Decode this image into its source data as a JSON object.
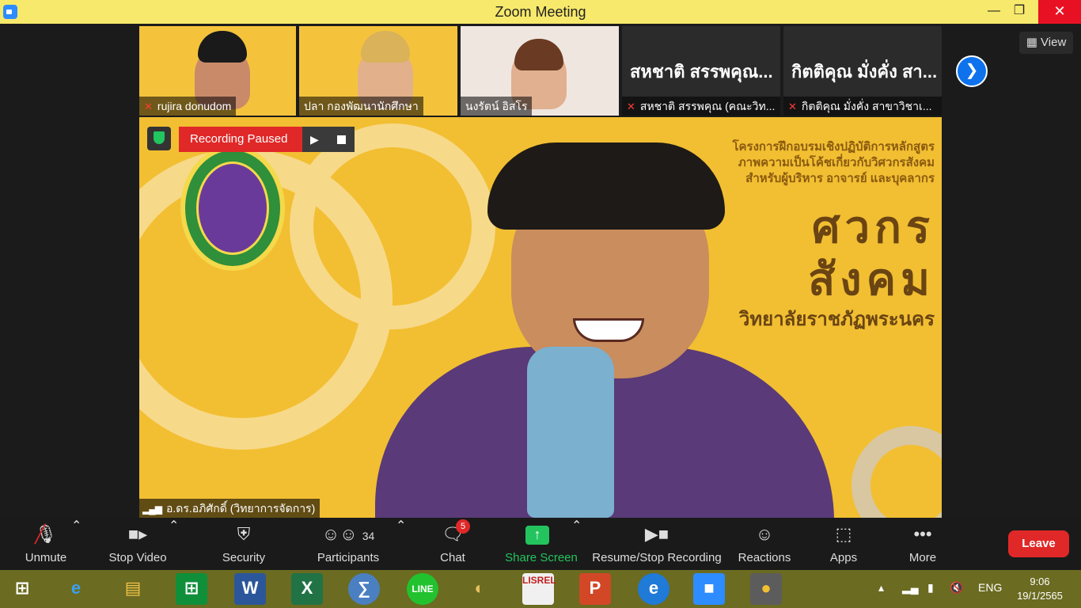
{
  "titlebar": {
    "title": "Zoom Meeting"
  },
  "thumbnails": [
    {
      "name": "rujira donudom",
      "muted": true
    },
    {
      "name": "ปลา กองพัฒนานักศึกษา",
      "muted": false
    },
    {
      "name": "นงรัตน์ อิสโร",
      "muted": false
    },
    {
      "display_name": "สหชาติ สรรพคุณ...",
      "name": "สหชาติ สรรพคุณ (คณะวิท...",
      "muted": true
    },
    {
      "display_name": "กิตติคุณ  มั่งคั่ง สา...",
      "name": "กิตติคุณ  มั่งคั่ง สาขาวิชาเ...",
      "muted": true
    }
  ],
  "view_button": {
    "label": "View"
  },
  "speaker": {
    "name": "อ.ดร.อภิศักดิ์ (วิทยาการจัดการ)",
    "recording_status": "Recording Paused",
    "banner_line1": "โครงการฝึกอบรมเชิงปฏิบัติการหลักสูตร",
    "banner_line2": "ภาพความเป็นโค้ชเกี่ยวกับวิศวกรสังคม",
    "banner_line3": "สำหรับผู้บริหาร อาจารย์ และบุคลากร",
    "banner_big1": "ศวกร",
    "banner_big2": "สังคม",
    "banner_sub": "วิทยาลัยราชภัฏพระนคร"
  },
  "toolbar": {
    "unmute": "Unmute",
    "stop_video": "Stop Video",
    "security": "Security",
    "participants": "Participants",
    "participants_count": "34",
    "chat": "Chat",
    "chat_badge": "5",
    "share_screen": "Share Screen",
    "resume_stop_recording": "Resume/Stop Recording",
    "reactions": "Reactions",
    "apps": "Apps",
    "more": "More",
    "leave": "Leave"
  },
  "taskbar": {
    "language": "ENG",
    "time": "9:06",
    "date": "19/1/2565"
  },
  "colors": {
    "titlebar": "#f7e96b",
    "leave": "#e02828",
    "share": "#23c45e",
    "taskbar": "#6b6b21"
  }
}
